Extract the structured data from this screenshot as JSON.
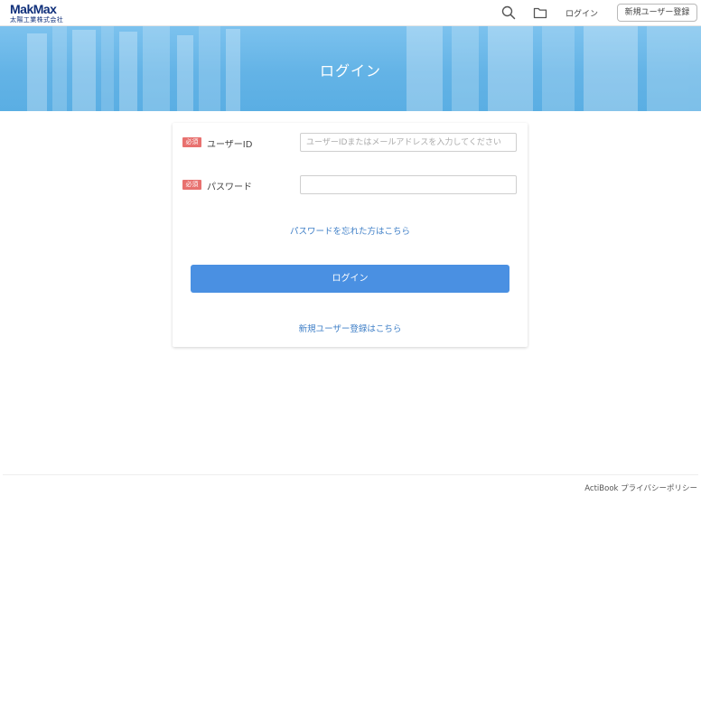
{
  "header": {
    "logo_main": "MakMax",
    "logo_sub": "太陽工業株式会社",
    "search_icon": "search-icon",
    "folder_icon": "folder-icon",
    "login_label": "ログイン",
    "register_label": "新規ユーザー登録"
  },
  "banner": {
    "title": "ログイン"
  },
  "form": {
    "required_badge": "必須",
    "userid_label": "ユーザーID",
    "userid_placeholder": "ユーザーIDまたはメールアドレスを入力してください",
    "userid_value": "",
    "password_label": "パスワード",
    "password_value": "",
    "forgot_link": "パスワードを忘れた方はこちら",
    "login_button": "ログイン",
    "register_link": "新規ユーザー登録はこちら"
  },
  "footer": {
    "brand": "ActiBook",
    "privacy": "プライバシーポリシー"
  },
  "colors": {
    "accent": "#4a90e2",
    "badge": "#e8716f",
    "link": "#3f7fc7",
    "banner": "#63b3e6"
  }
}
